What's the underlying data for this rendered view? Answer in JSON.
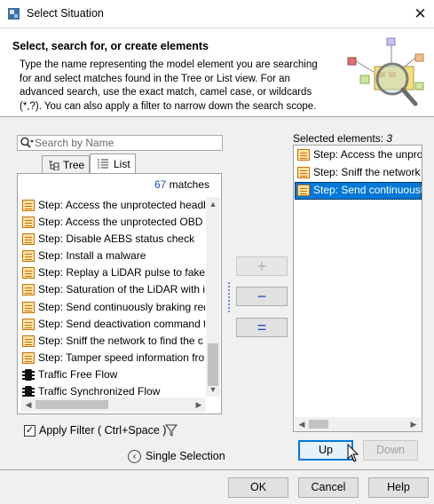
{
  "window": {
    "title": "Select Situation",
    "close_glyph": "✕"
  },
  "header": {
    "title": "Select, search for, or create elements",
    "description": "Type the name representing the model element you are searching for and select matches found in the Tree or List view. For an advanced search, use the exact match, camel case, or wildcards (*,?). You can also apply a filter to narrow down the search scope.",
    "illustration_icon": "search-elements-illustration-icon"
  },
  "search": {
    "placeholder": "Search by Name",
    "value": ""
  },
  "tabs": [
    {
      "label": "Tree",
      "icon": "tree-icon",
      "active": false
    },
    {
      "label": "List",
      "icon": "list-icon",
      "active": true
    }
  ],
  "results": {
    "count": "67",
    "count_suffix": " matches",
    "items": [
      {
        "label": "Step: Access the unprotected headla",
        "icon": "step-icon"
      },
      {
        "label": "Step: Access the unprotected OBD p",
        "icon": "step-icon"
      },
      {
        "label": "Step: Disable AEBS status check",
        "icon": "step-icon"
      },
      {
        "label": "Step: Install a malware",
        "icon": "step-icon"
      },
      {
        "label": "Step: Replay a LiDAR pulse to fake o",
        "icon": "step-icon"
      },
      {
        "label": "Step: Saturation of the LiDAR with ir",
        "icon": "step-icon"
      },
      {
        "label": "Step: Send continuously braking req",
        "icon": "step-icon"
      },
      {
        "label": "Step: Send deactivation command t",
        "icon": "step-icon"
      },
      {
        "label": "Step: Sniff the network to find the c",
        "icon": "step-icon"
      },
      {
        "label": "Step: Tamper speed information fro",
        "icon": "step-icon"
      },
      {
        "label": "Traffic Free Flow",
        "icon": "traffic-light-icon"
      },
      {
        "label": "Traffic Synchronized Flow",
        "icon": "traffic-light-icon"
      }
    ]
  },
  "apply_filter": {
    "label": "Apply Filter ( Ctrl+Space )",
    "checked": true,
    "check_glyph": "✓"
  },
  "single_selection": {
    "label": "Single Selection",
    "glyph": "‹"
  },
  "transfer_buttons": {
    "add": "+",
    "remove": "−",
    "remove_all": "="
  },
  "selected": {
    "label_prefix": "Selected elements: ",
    "count": "3",
    "items": [
      {
        "label": "Step: Access the unprot",
        "icon": "step-icon",
        "selected": false
      },
      {
        "label": "Step: Sniff the network",
        "icon": "step-icon",
        "selected": false
      },
      {
        "label": "Step: Send continuously",
        "icon": "step-icon",
        "selected": true
      }
    ]
  },
  "order_buttons": {
    "up": "Up",
    "down": "Down"
  },
  "dialog_buttons": {
    "ok": "OK",
    "cancel": "Cancel",
    "help": "Help"
  },
  "scroll_glyphs": {
    "up": "▲",
    "down": "▼",
    "left": "◀",
    "right": "▶"
  },
  "colors": {
    "accent": "#0078d7",
    "match_count": "#1f4fb5",
    "step_icon_fill": "#ffe2a8",
    "step_icon_border": "#c57100"
  }
}
